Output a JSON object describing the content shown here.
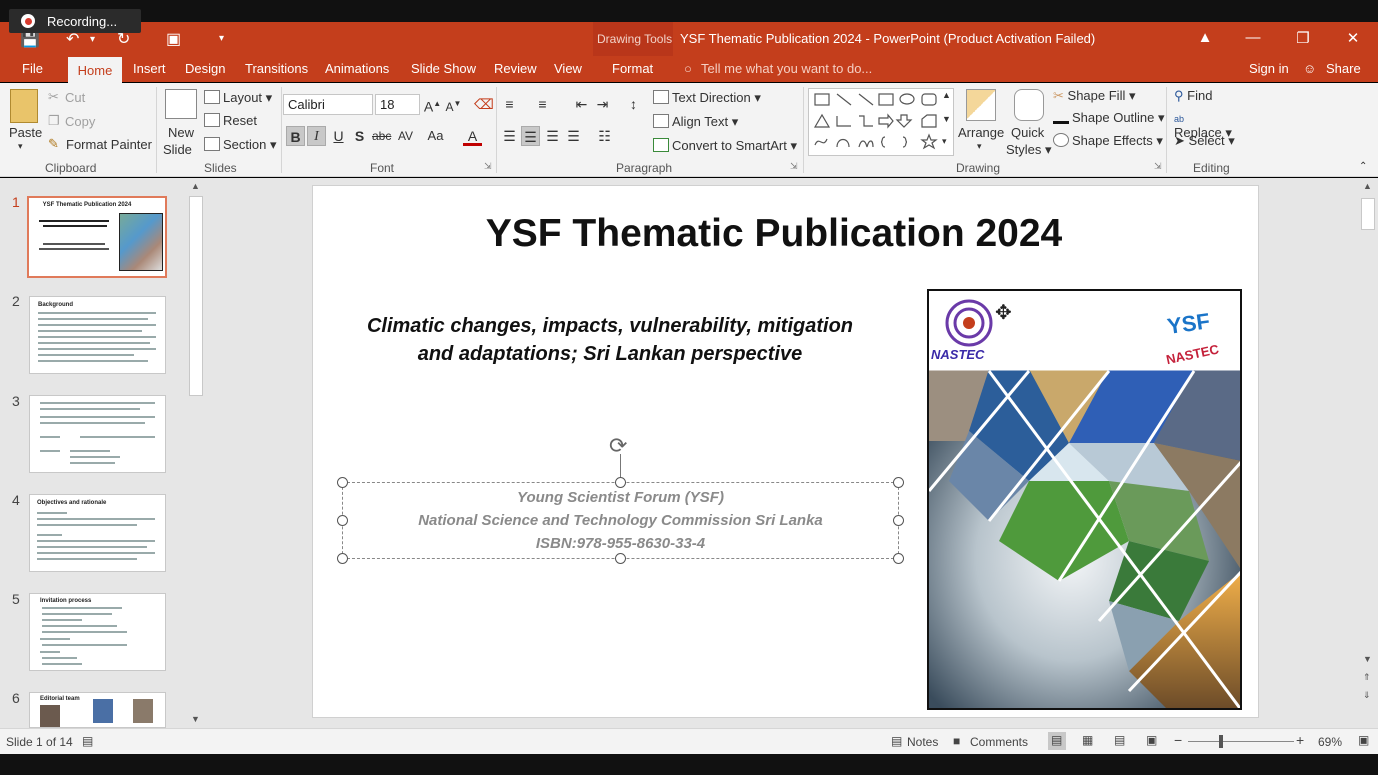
{
  "recording": {
    "label": "Recording..."
  },
  "window": {
    "contextual_tab_group": "Drawing Tools",
    "title": "YSF Thematic Publication 2024 - PowerPoint (Product Activation Failed)"
  },
  "tabs": [
    "File",
    "Home",
    "Insert",
    "Design",
    "Transitions",
    "Animations",
    "Slide Show",
    "Review",
    "View",
    "Format"
  ],
  "tell_me": {
    "placeholder": "Tell me what you want to do..."
  },
  "account": {
    "sign_in": "Sign in",
    "share": "Share"
  },
  "ribbon": {
    "clipboard": {
      "label": "Clipboard",
      "paste": "Paste",
      "cut": "Cut",
      "copy": "Copy",
      "format_painter": "Format Painter"
    },
    "slides": {
      "label": "Slides",
      "new_slide_1": "New",
      "new_slide_2": "Slide",
      "layout": "Layout",
      "reset": "Reset",
      "section": "Section"
    },
    "font": {
      "label": "Font",
      "font_name": "Calibri",
      "font_size": "18"
    },
    "paragraph": {
      "label": "Paragraph",
      "text_direction": "Text Direction",
      "align_text": "Align Text",
      "convert_smartart": "Convert to SmartArt"
    },
    "drawing": {
      "label": "Drawing",
      "arrange": "Arrange",
      "quick_styles_1": "Quick",
      "quick_styles_2": "Styles",
      "shape_fill": "Shape Fill",
      "shape_outline": "Shape Outline",
      "shape_effects": "Shape Effects"
    },
    "editing": {
      "label": "Editing",
      "find": "Find",
      "replace": "Replace",
      "select": "Select"
    }
  },
  "thumbnails": [
    {
      "num": "1",
      "title": "YSF Thematic Publication 2024"
    },
    {
      "num": "2",
      "title": "Background"
    },
    {
      "num": "3",
      "title": ""
    },
    {
      "num": "4",
      "title": "Objectives and rationale"
    },
    {
      "num": "5",
      "title": "Invitation process"
    },
    {
      "num": "6",
      "title": "Editorial team"
    }
  ],
  "slide": {
    "title": "YSF Thematic Publication 2024",
    "subtitle_line1": "Climatic changes, impacts, vulnerability, mitigation",
    "subtitle_line2": "and adaptations; Sri Lankan perspective",
    "body_line1": "Young Scientist Forum (YSF)",
    "body_line2": "National Science and Technology Commission Sri Lanka",
    "body_line3": "ISBN:978-955-8630-33-4",
    "cover_logo_left": "NASTEC",
    "cover_logo_right_1": "YSF",
    "cover_logo_right_2": "NASTEC"
  },
  "status": {
    "slide_info": "Slide 1 of 14",
    "notes": "Notes",
    "comments": "Comments",
    "zoom": "69%"
  },
  "colors": {
    "accent": "#c43e1c",
    "ribbon_bg": "#f3f3f3"
  }
}
